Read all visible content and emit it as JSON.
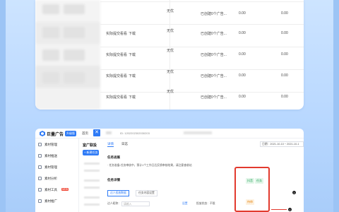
{
  "table": {
    "rows": [
      {
        "a": "",
        "b": "",
        "c": "无优",
        "d": "已创建0个广告...",
        "e": "0.00",
        "f": "0.00"
      },
      {
        "a": "实际提交看看",
        "b": "下载",
        "c": "无优",
        "d": "已创建0个广告...",
        "e": "0.00",
        "f": "0.00"
      },
      {
        "a": "实际提交看看",
        "b": "下载",
        "c": "无优",
        "d": "已创建0个广告...",
        "e": "0.00",
        "f": "0.00"
      },
      {
        "a": "实际提交看看",
        "b": "下载",
        "c": "无优",
        "d": "已创建0个广告...",
        "e": "0.00",
        "f": "0.00"
      },
      {
        "a": "实际提交看看",
        "b": "下载",
        "c": "无优",
        "d": "已创建0个广告...",
        "e": "0.00",
        "f": "0.00"
      },
      {
        "a": "",
        "b": "",
        "c": "",
        "d": "",
        "e": "",
        "f": ""
      }
    ]
  },
  "app": {
    "brand": "巨量广告",
    "badge": "升级版",
    "nav_home": "首页",
    "close_glyph": "✕",
    "info_id": "ID: 1202202302030203",
    "sidebar": [
      {
        "label": "素材管理",
        "hot": ""
      },
      {
        "label": "素材推送",
        "hot": ""
      },
      {
        "label": "素材管理",
        "hot": ""
      },
      {
        "label": "素材分析",
        "hot": ""
      },
      {
        "label": "素材工具",
        "hot": "NEW"
      },
      {
        "label": "素材推广",
        "hot": ""
      }
    ],
    "mid_title": "室广联投",
    "new_button": "+ 新建任务",
    "tabs": [
      "详情",
      "日志"
    ],
    "date_range": "日期：2021-10-10 ~ 2021-10-1",
    "section1_title": "任务进展",
    "section1_text": "· 任务准备-任务审核中，预计1个工作日后反馈审核结果，请注意查收站",
    "section2_title": "任务详情",
    "sub_tabs": [
      "达人投放数据",
      "任务内容设置"
    ],
    "field_label": "达人昵称：",
    "field_placeholder": "请输入",
    "field2_label": "设置",
    "field3_label": "投放状态：不限",
    "chip1": "抖音",
    "chip2": "任务",
    "chip3": "待审",
    "dot_glyph": "•"
  },
  "colors": {
    "accent": "#2f7bf6",
    "highlight": "#e23a2e",
    "hot": "#f04b3a"
  }
}
